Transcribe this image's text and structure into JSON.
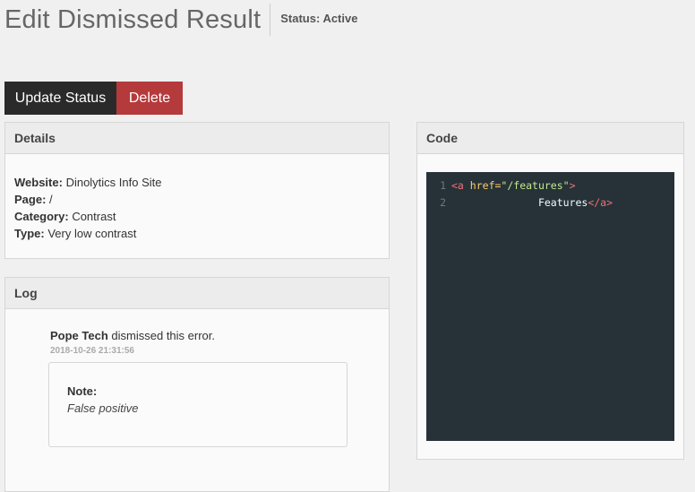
{
  "header": {
    "title": "Edit Dismissed Result",
    "status_label": "Status:",
    "status_value": "Active"
  },
  "actions": {
    "update_status": "Update Status",
    "delete": "Delete"
  },
  "details": {
    "heading": "Details",
    "rows": [
      {
        "label": "Website:",
        "value": "Dinolytics Info Site"
      },
      {
        "label": "Page:",
        "value": "/"
      },
      {
        "label": "Category:",
        "value": "Contrast"
      },
      {
        "label": "Type:",
        "value": "Very low contrast"
      }
    ]
  },
  "log": {
    "heading": "Log",
    "author": "Pope Tech",
    "action": "dismissed this error.",
    "timestamp": "2018-10-26 21:31:56",
    "note_label": "Note:",
    "note_text": "False positive"
  },
  "code": {
    "heading": "Code",
    "lines": [
      {
        "number": "1",
        "open_tag": "<a",
        "attr_name": "href=",
        "attr_value": "\"/features\"",
        "close": ">"
      },
      {
        "number": "2",
        "indent": "              ",
        "text": "Features",
        "end_tag": "</a>"
      }
    ]
  },
  "colors": {
    "background": "#f0f0f0",
    "dark_button": "#2a2a2a",
    "delete_button": "#b53a3c",
    "code_background": "#263238"
  }
}
